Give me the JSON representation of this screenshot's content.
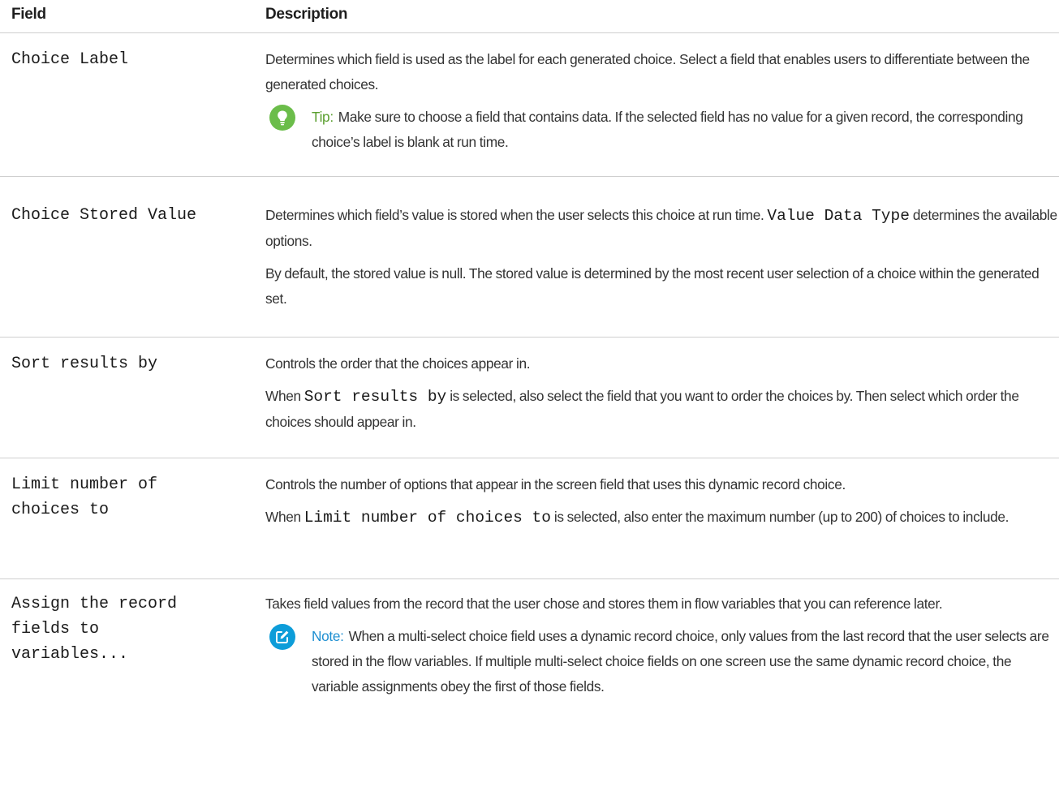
{
  "header": {
    "field": "Field",
    "description": "Description"
  },
  "rows": {
    "choice_label": {
      "field": "Choice Label",
      "p1": "Determines which field is used as the label for each generated choice. Select a field that enables users to differentiate between the generated choices.",
      "tip": {
        "lead": "Tip:",
        "text": "Make sure to choose a field that contains data. If the selected field has no value for a given record, the corresponding choice’s label is blank at run time.",
        "icon": "lightbulb-icon"
      }
    },
    "stored_value": {
      "field": "Choice Stored Value",
      "p1_a": "Determines which field’s value is stored when the user selects this choice at run time.",
      "p1_code": "Value Data Type",
      "p1_b": "determines the available options.",
      "p2": "By default, the stored value is null. The stored value is determined by the most recent user selection of a choice within the generated set."
    },
    "sort": {
      "field": "Sort results by",
      "p1": "Controls the order that the choices appear in.",
      "p2_a": "When",
      "p2_code": "Sort results by",
      "p2_b": "is selected, also select the field that you want to order the choices by. Then select which order the choices should appear in."
    },
    "limit": {
      "field": "Limit number of\nchoices to",
      "p1": "Controls the number of options that appear in the screen field that uses this dynamic record choice.",
      "p2_a": "When",
      "p2_code": "Limit number of choices to",
      "p2_b": "is selected, also enter the maximum number (up to 200) of choices to include."
    },
    "assign": {
      "field": "Assign the record\nfields to\nvariables...",
      "p1": "Takes field values from the record that the user chose and stores them in flow variables that you can reference later.",
      "note": {
        "lead": "Note:",
        "text": "When a multi-select choice field uses a dynamic record choice, only values from the last record that the user selects are stored in the flow variables. If multiple multi-select choice fields on one screen use the same dynamic record choice, the variable assignments obey the first of those fields.",
        "icon": "edit-note-icon"
      }
    }
  },
  "colors": {
    "tip": "#6bbd4a",
    "note": "#0d9dd9",
    "rule": "#cfcfcf",
    "text": "#333333"
  }
}
